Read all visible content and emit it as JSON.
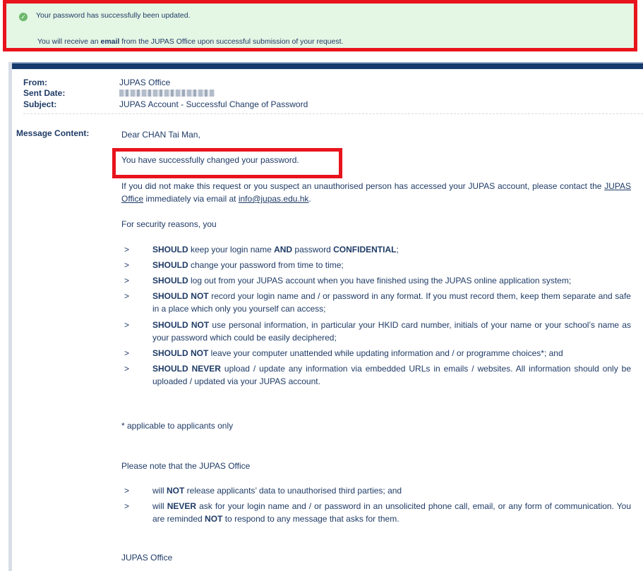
{
  "banner": {
    "line1": "Your password has successfully been updated.",
    "line2_pre": "You will receive an ",
    "line2_bold": "email",
    "line2_post": " from the JUPAS Office upon successful submission of your request."
  },
  "email": {
    "from_label": "From:",
    "from_value": "JUPAS Office",
    "sent_label": "Sent Date:",
    "subject_label": "Subject:",
    "subject_value": "JUPAS Account - Successful Change of Password",
    "message_label": "Message Content:",
    "greeting": "Dear CHAN Tai Man,",
    "highlight": "You have successfully changed your password.",
    "para1_pre": "If you did not make this request or you suspect an unauthorised person has accessed your JUPAS account, please contact the ",
    "para1_link1": "JUPAS Office",
    "para1_mid": " immediately via email at ",
    "para1_link2": "info@jupas.edu.hk",
    "para1_post": ".",
    "security_intro": "For security reasons, you",
    "security_items": [
      {
        "b1": "SHOULD",
        "t1": " keep your login name ",
        "b2": "AND",
        "t2": " password ",
        "b3": "CONFIDENTIAL",
        "t3": ";"
      },
      {
        "b1": "SHOULD",
        "t1": " change your password from time to time;"
      },
      {
        "b1": "SHOULD",
        "t1": " log out from your JUPAS account when you have finished using the JUPAS online application system;"
      },
      {
        "b1": "SHOULD NOT",
        "t1": " record your login name and / or password in any format. If you must record them, keep them separate and safe in a place which only you yourself can access;"
      },
      {
        "b1": "SHOULD NOT",
        "t1": " use personal information, in particular your HKID card number, initials of your name or your school’s name as your password which could be easily deciphered;"
      },
      {
        "b1": "SHOULD NOT",
        "t1": " leave your computer unattended while updating information and / or programme choices*; and"
      },
      {
        "b1": "SHOULD NEVER",
        "t1": " upload / update any information via embedded URLs in emails / websites. All information should only be uploaded / updated via your JUPAS account."
      }
    ],
    "footnote": "* applicable to applicants only",
    "office_intro": "Please note that the JUPAS Office",
    "office_items": [
      {
        "t0": "will ",
        "b1": "NOT",
        "t1": " release applicants’ data to unauthorised third parties; and"
      },
      {
        "t0": "will ",
        "b1": "NEVER",
        "t1": " ask for your login name and / or password in an unsolicited phone call, email, or any form of communication. You are reminded ",
        "b2": "NOT",
        "t2": " to respond to any message that asks for them."
      }
    ],
    "signature": "JUPAS Office",
    "bullet_glyph": ">"
  },
  "colors": {
    "text": "#1f3b66",
    "banner_bg": "#e4f6e4",
    "highlight_border": "#e8141c",
    "panel_bar": "#163a6b"
  }
}
